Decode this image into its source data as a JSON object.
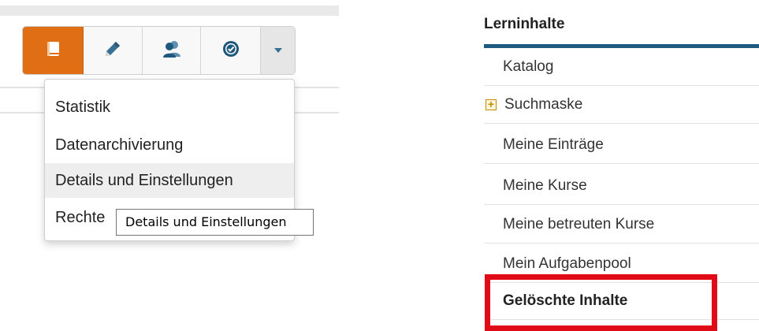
{
  "toolbar": {
    "buttons": [
      {
        "icon": "book-icon",
        "active": true
      },
      {
        "icon": "pencil-icon",
        "active": false
      },
      {
        "icon": "users-icon",
        "active": false
      },
      {
        "icon": "badge-check-icon",
        "active": false
      },
      {
        "icon": "caret-down-icon",
        "active": false
      }
    ],
    "accent_color": "#e06e14"
  },
  "dropdown": {
    "items": [
      "Statistik",
      "Datenarchivierung",
      "Details und Einstellungen",
      "Rechte"
    ],
    "hovered_index": 2
  },
  "tooltip": {
    "text": "Details und Einstellungen"
  },
  "sidebar": {
    "title": "Lerninhalte",
    "items": [
      {
        "label": "Katalog"
      },
      {
        "label": "Suchmaske",
        "expander": "+"
      },
      {
        "label": "Meine Einträge"
      },
      {
        "label": "Meine Kurse"
      },
      {
        "label": "Meine betreuten Kurse"
      },
      {
        "label": "Mein Aufgabenpool"
      },
      {
        "label": "Gelöschte Inhalte",
        "bold": true
      }
    ],
    "accent_color": "#1c5a80",
    "highlight_color": "#e00b16"
  }
}
